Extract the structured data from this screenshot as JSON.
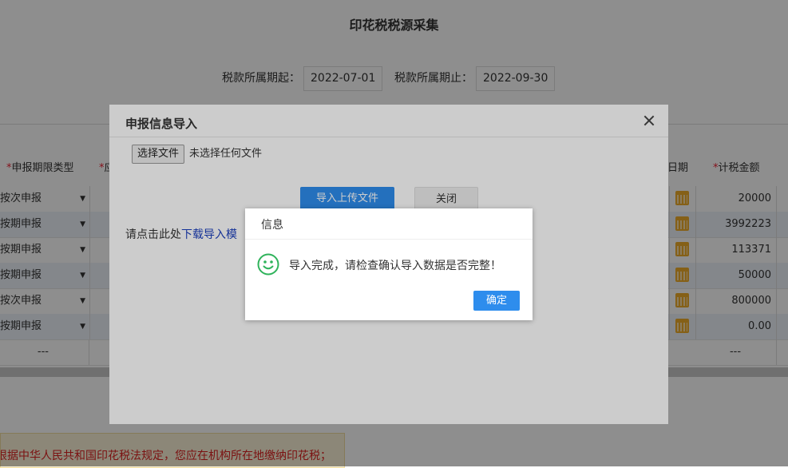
{
  "page": {
    "title": "印花税税源采集"
  },
  "period": {
    "start_label": "税款所属期起：",
    "start_value": "2022-07-01",
    "end_label": "税款所属期止：",
    "end_value": "2022-09-30"
  },
  "table": {
    "headers": {
      "period_type": "申报期限类型",
      "partial_left": "应",
      "date": "日期",
      "amount": "计税金额"
    },
    "rows": [
      {
        "type": "按次申报",
        "amount": "20000"
      },
      {
        "type": "按期申报",
        "amount": "3992223"
      },
      {
        "type": "按期申报",
        "amount": "113371"
      },
      {
        "type": "按期申报",
        "amount": "50000"
      },
      {
        "type": "按次申报",
        "amount": "800000"
      },
      {
        "type": "按期申报",
        "amount": "0.00"
      }
    ],
    "total_left": "---",
    "total_amount": "---",
    "dropdown_glyph": "▼"
  },
  "notice": {
    "text": "根据中华人民共和国印花税法规定，您应在机构所在地缴纳印花税；"
  },
  "import_dialog": {
    "title": "申报信息导入",
    "file_button": "选择文件",
    "file_status": "未选择任何文件",
    "upload_button": "导入上传文件",
    "close_button": "关闭",
    "download_prefix": "请点击此处",
    "download_link": "下载导入模"
  },
  "message_dialog": {
    "title": "信息",
    "text": "导入完成，请检查确认导入数据是否完整！",
    "ok_button": "确定",
    "icon": "smile-icon",
    "icon_color": "#2fb35b"
  }
}
